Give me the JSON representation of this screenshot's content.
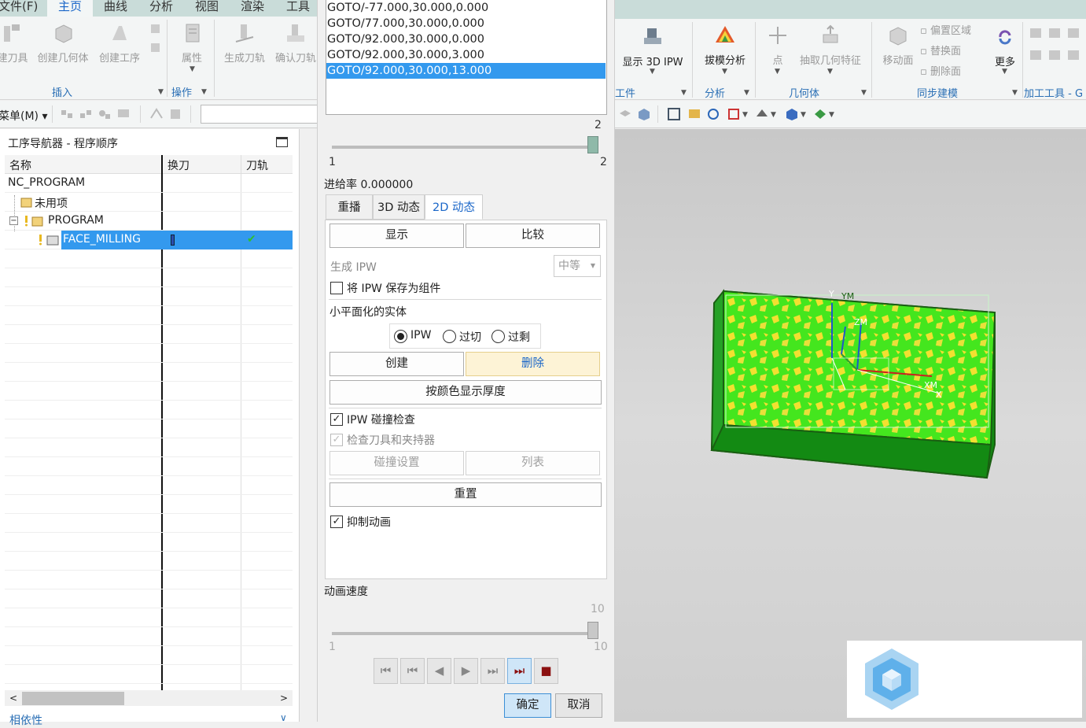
{
  "ribbon": {
    "tabs": [
      "文件(F)",
      "主页",
      "曲线",
      "分析",
      "视图",
      "渲染",
      "工具"
    ],
    "active_tab": "主页",
    "left_buttons": [
      "建刀具",
      "创建几何体",
      "创建工序",
      "属性",
      "生成刀轨",
      "确认刀轨"
    ],
    "groups_left": [
      "插入",
      "操作"
    ],
    "menu_label": "菜单(M)",
    "right_buttons": [
      "显示 3D IPW",
      "拔模分析",
      "点",
      "抽取几何特征",
      "移动面",
      "更多"
    ],
    "sync_small": [
      "偏置区域",
      "替换面",
      "删除面"
    ],
    "groups_right": [
      "工件",
      "分析",
      "几何体",
      "同步建模",
      "加工工具 - G"
    ]
  },
  "navigator": {
    "title": "工序导航器 - 程序顺序",
    "columns": [
      "名称",
      "换刀",
      "刀轨"
    ],
    "rows": [
      {
        "name": "NC_PROGRAM"
      },
      {
        "name": "未用项"
      },
      {
        "name": "PROGRAM"
      },
      {
        "name": "FACE_MILLING",
        "toolpath_ok": "✔"
      }
    ],
    "bottom_label": "相依性"
  },
  "dialog": {
    "goto_lines": [
      "GOTO/-77.000,30.000,0.000",
      "GOTO/77.000,30.000,0.000",
      "GOTO/92.000,30.000,0.000",
      "GOTO/92.000,30.000,3.000",
      "GOTO/92.000,30.000,13.000"
    ],
    "selected_line_index": 4,
    "step_slider": {
      "value": "2",
      "min": "1",
      "max": "2"
    },
    "feed_rate": "进给率 0.000000",
    "tabs": [
      "重播",
      "3D 动态",
      "2D 动态"
    ],
    "active_tab": "2D 动态",
    "btn_display": "显示",
    "btn_compare": "比较",
    "generate_ipw_label": "生成 IPW",
    "generate_ipw_value": "中等",
    "save_ipw_label": "将 IPW 保存为组件",
    "faceted_label": "小平面化的实体",
    "radio_options": [
      "IPW",
      "过切",
      "过剩"
    ],
    "radio_selected": "IPW",
    "btn_create": "创建",
    "btn_delete": "删除",
    "btn_thickness": "按颜色显示厚度",
    "collision_label": "IPW 碰撞检查",
    "check_tool_label": "检查刀具和夹持器",
    "btn_collision_settings": "碰撞设置",
    "btn_list": "列表",
    "btn_reset": "重置",
    "suppress_label": "抑制动画",
    "speed_label": "动画速度",
    "speed_slider": {
      "value": "10",
      "min": "1",
      "max": "10"
    },
    "ok": "确定",
    "cancel": "取消"
  },
  "viewport": {
    "axis_labels": [
      "Y",
      "YM",
      "ZM",
      "XM",
      "X"
    ],
    "part_top_color": "#44e61e",
    "part_side_color": "#138a13",
    "part_edge_color": "#1a5e12",
    "residual_color": "#f2e030"
  },
  "colors": {
    "accent": "#1a66c8",
    "selection": "#3399ee",
    "ribbon_tab_bg": "#c9dcd9"
  }
}
